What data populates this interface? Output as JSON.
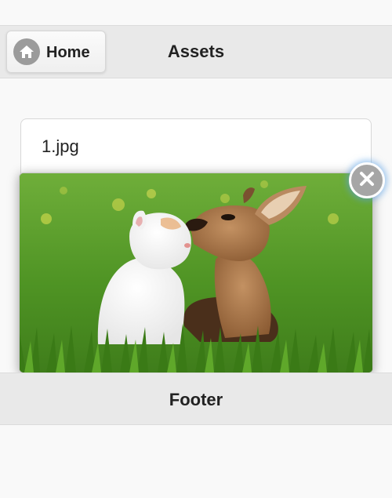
{
  "header": {
    "home_button": {
      "label": "Home",
      "icon": "home-icon"
    },
    "title": "Assets"
  },
  "list": {
    "items": [
      {
        "label": "1.jpg"
      }
    ]
  },
  "popup": {
    "image": {
      "subject": "kitten-and-fawn-photo"
    },
    "close_button": {
      "icon": "close-icon"
    }
  },
  "footer": {
    "title": "Footer"
  },
  "colors": {
    "bar_background": "#e9e9e9",
    "page_background": "#f9f9f9",
    "close_glow": "#5aa0e6"
  }
}
